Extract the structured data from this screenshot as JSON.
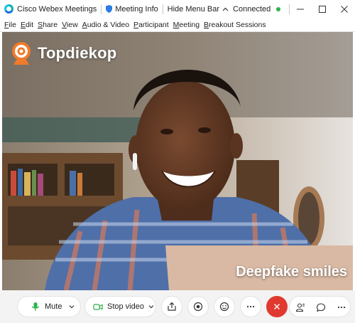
{
  "titlebar": {
    "app_name": "Cisco Webex Meetings",
    "meeting_info": "Meeting Info",
    "hide_menu_bar": "Hide Menu Bar",
    "status": "Connected",
    "status_color": "#2bb14b"
  },
  "menu": {
    "items": [
      {
        "accel": "F",
        "rest": "ile"
      },
      {
        "accel": "E",
        "rest": "dit"
      },
      {
        "accel": "S",
        "rest": "hare"
      },
      {
        "accel": "V",
        "rest": "iew"
      },
      {
        "accel": "A",
        "rest": "udio & Video"
      },
      {
        "accel": "P",
        "rest": "articipant"
      },
      {
        "accel": "M",
        "rest": "eeting"
      },
      {
        "accel": "B",
        "rest": "reakout Sessions"
      }
    ]
  },
  "video": {
    "watermark": "Topdiekop",
    "caption": "Deepfake smiles"
  },
  "controls": {
    "mute_label": "Mute",
    "stop_video_label": "Stop video",
    "icons": [
      "microphone-icon",
      "video-camera-icon",
      "share-icon",
      "record-icon",
      "reactions-icon",
      "more-icon",
      "end-call-icon",
      "participants-icon",
      "chat-icon",
      "more-panels-icon"
    ],
    "end_color": "#e0392f"
  }
}
